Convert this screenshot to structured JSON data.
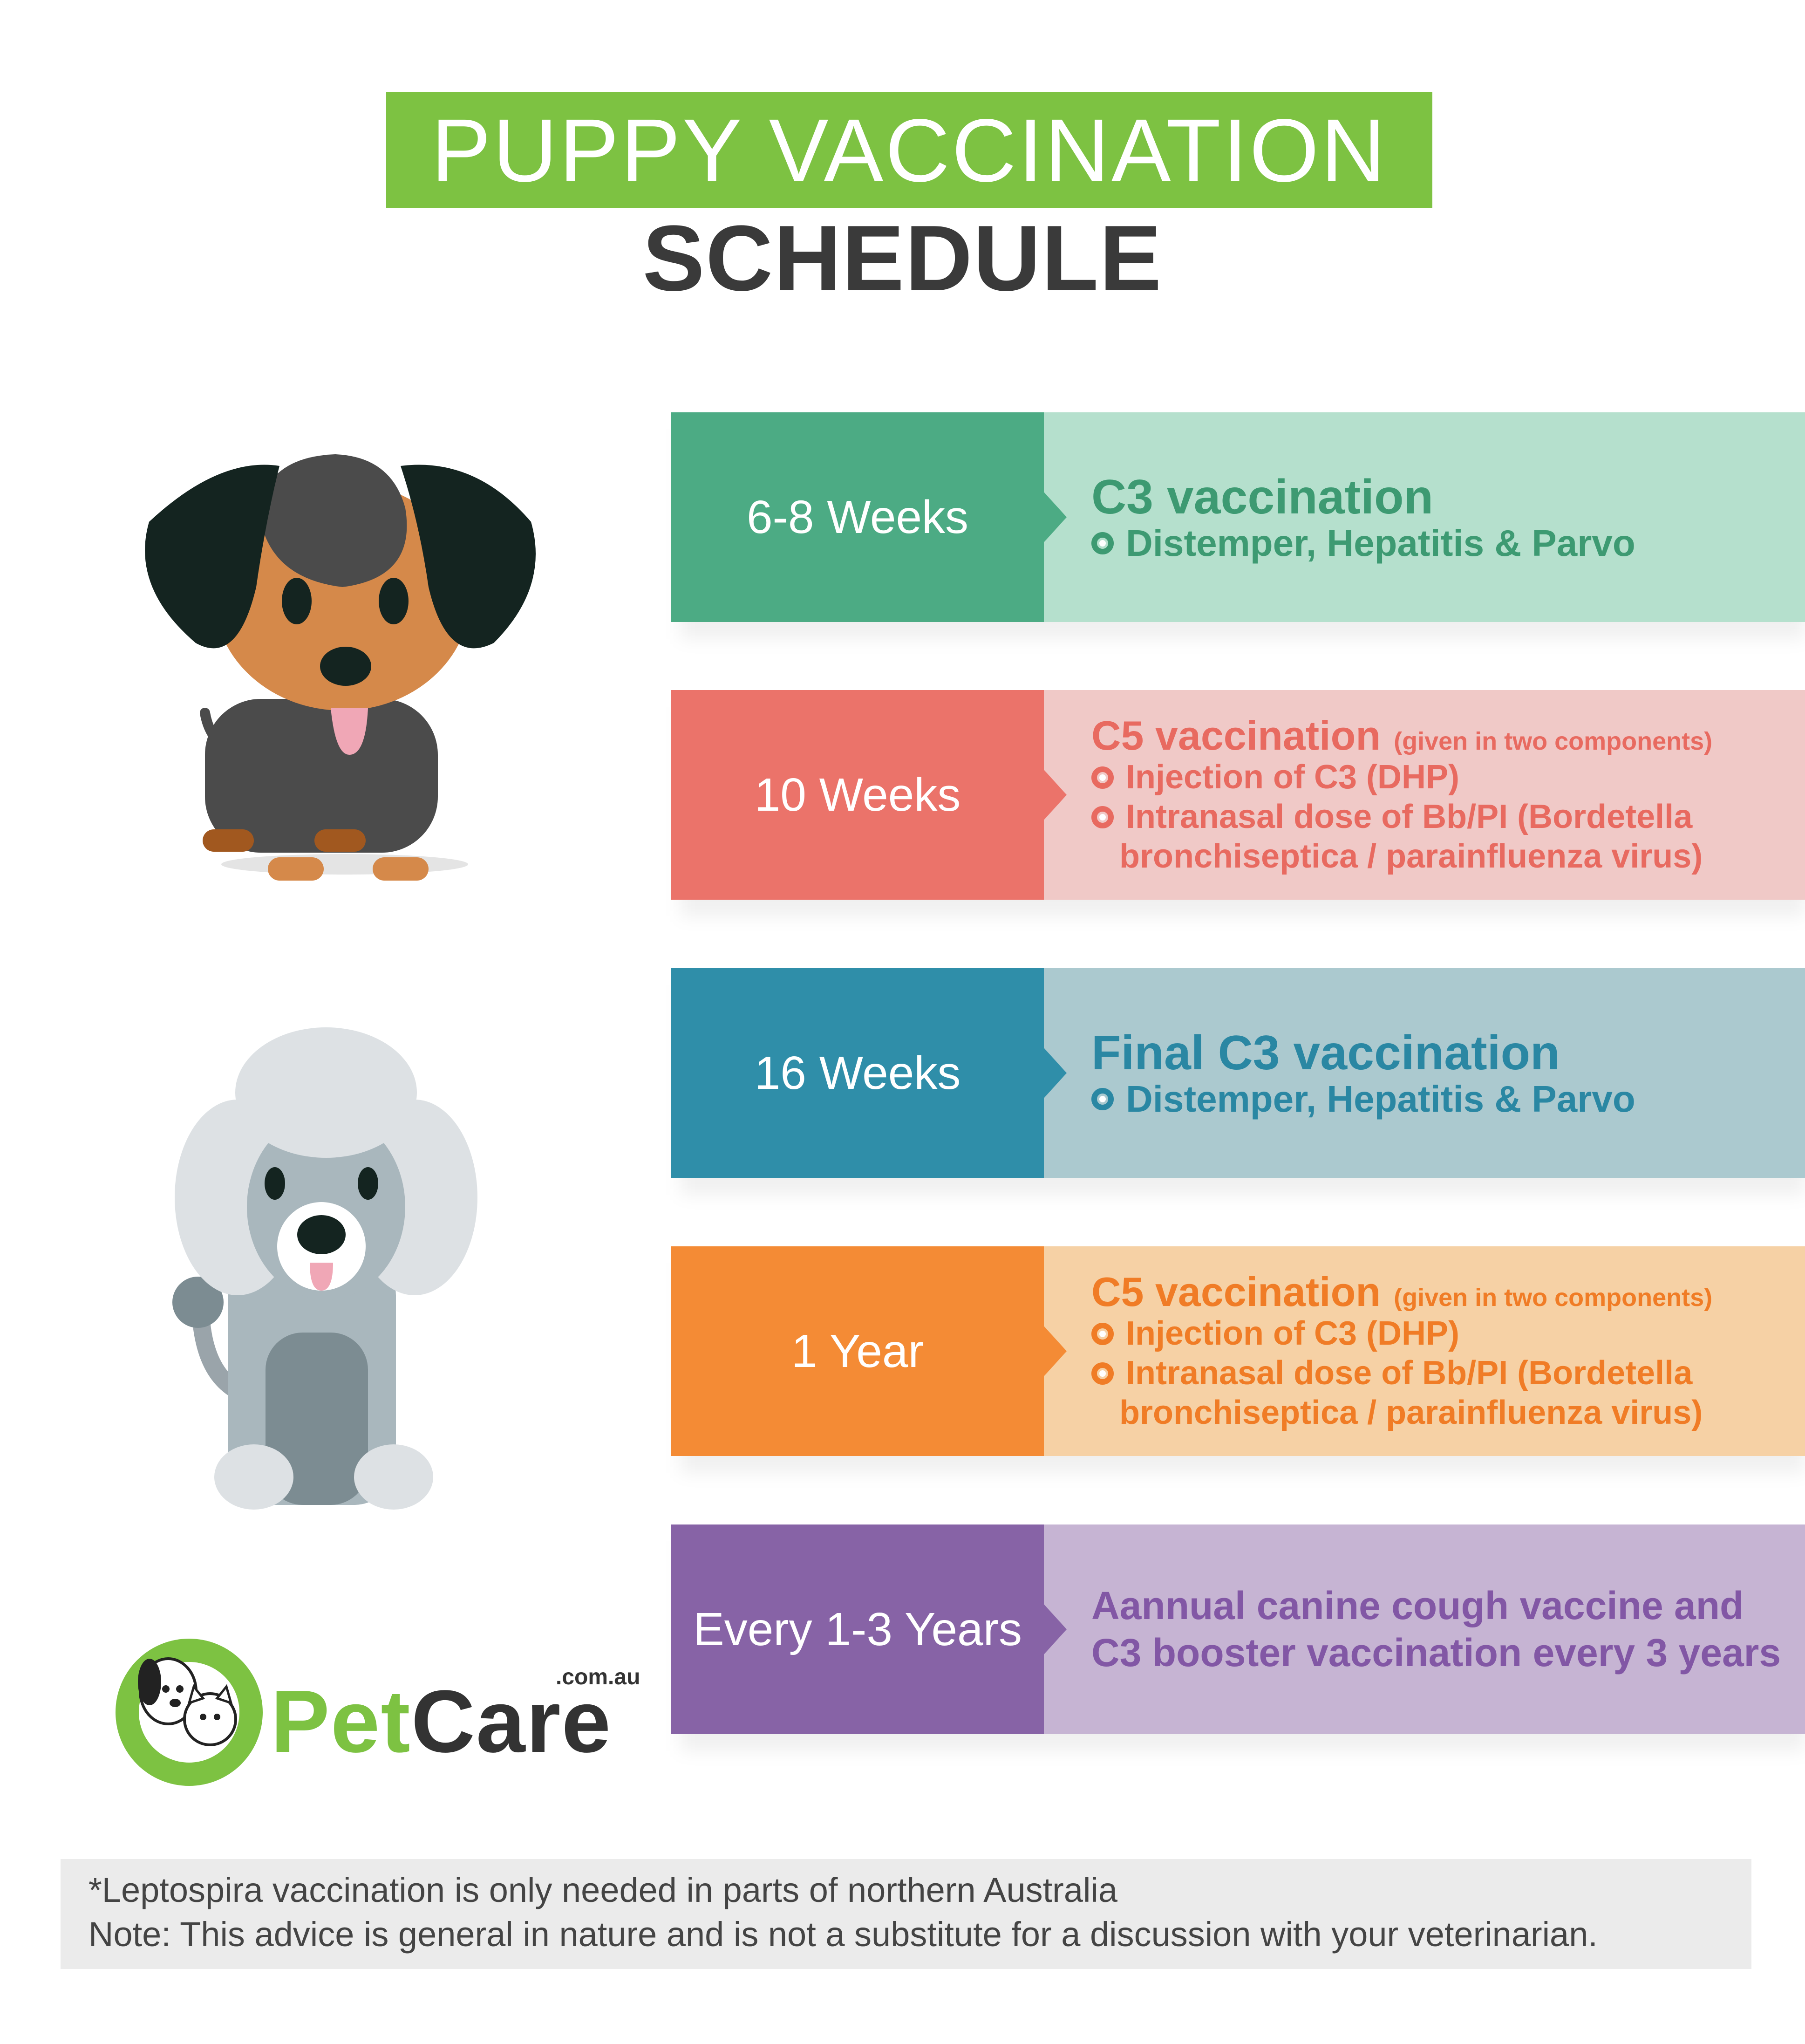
{
  "title": {
    "line1": "PUPPY VACCINATION",
    "line2": "SCHEDULE",
    "accent": "#7dc242"
  },
  "rows": [
    {
      "age": "6-8 Weeks",
      "heading": "C3 vaccination",
      "bullets": [
        "Distemper, Hepatitis & Parvo"
      ],
      "colors": {
        "left": "#4cab84",
        "right": "#b5e0cd",
        "text": "#3d9a72"
      }
    },
    {
      "age": "10 Weeks",
      "heading": "C5 vaccination",
      "heading_note": "(given in two components)",
      "bullets": [
        "Injection of C3 (DHP)",
        "Intranasal dose of Bb/PI (Bordetella"
      ],
      "continuation": "bronchiseptica / parainfluenza virus)",
      "colors": {
        "left": "#eb736a",
        "right": "#f0c9c7",
        "text": "#e86a60"
      }
    },
    {
      "age": "16 Weeks",
      "heading": "Final C3 vaccination",
      "bullets": [
        "Distemper, Hepatitis & Parvo"
      ],
      "colors": {
        "left": "#2f8ea9",
        "right": "#abc9cf",
        "text": "#2a87a3"
      }
    },
    {
      "age": "1 Year",
      "heading": "C5 vaccination",
      "heading_note": "(given in two components)",
      "bullets": [
        "Injection of C3 (DHP)",
        "Intranasal dose of Bb/PI (Bordetella"
      ],
      "continuation": "bronchiseptica / parainfluenza virus)",
      "colors": {
        "left": "#f48b35",
        "right": "#f6d1a5",
        "text": "#f07c26"
      }
    },
    {
      "age": "Every 1-3 Years",
      "lines": [
        "Aannual canine cough vaccine and",
        "C3 booster vaccination every 3 years"
      ],
      "colors": {
        "left": "#8763a6",
        "right": "#c6b4d3",
        "text": "#8257a5"
      }
    }
  ],
  "logo": {
    "word_pet": "Pet",
    "word_care": "Care",
    "domain": ".com.au",
    "color_green": "#7dc242",
    "color_dark": "#333333"
  },
  "footer": {
    "line1": "*Leptospira vaccination is only needed in parts of northern Australia",
    "line2": "Note:  This advice is general in nature and is not a substitute for a discussion with your veterinarian."
  }
}
